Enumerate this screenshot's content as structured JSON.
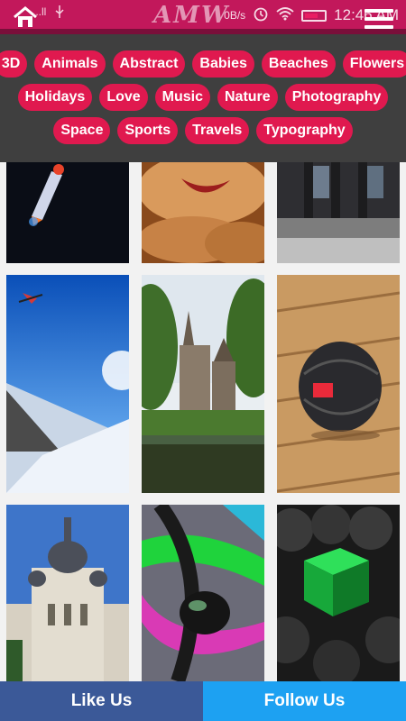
{
  "status_bar": {
    "signal_text": "...ll",
    "usb_icon": "usb-icon",
    "speed": "0B/s",
    "alarm_icon": "alarm-icon",
    "wifi_icon": "wifi-icon",
    "battery_icon": "battery-icon",
    "time": "12:46 AM"
  },
  "header": {
    "brand": "AMW",
    "home_icon": "home-icon",
    "menu_icon": "hamburger-menu-icon"
  },
  "categories": {
    "row1": [
      "3D",
      "Animals",
      "Abstract",
      "Babies",
      "Beaches",
      "Flowers"
    ],
    "row2": [
      "Holidays",
      "Love",
      "Music",
      "Nature",
      "Photography"
    ],
    "row3": [
      "Space",
      "Sports",
      "Travels",
      "Typography"
    ]
  },
  "gallery": {
    "thumbnails": [
      {
        "subject": "space rocket"
      },
      {
        "subject": "baby"
      },
      {
        "subject": "modern building"
      },
      {
        "subject": "snowboard jump"
      },
      {
        "subject": "castle by pond"
      },
      {
        "subject": "red-black sphere on wood"
      },
      {
        "subject": "cathedral"
      },
      {
        "subject": "neon abstract"
      },
      {
        "subject": "green cube among spheres"
      }
    ]
  },
  "bottom": {
    "like_label": "Like Us",
    "follow_label": "Follow Us"
  },
  "colors": {
    "accent": "#e0194f",
    "header": "#c2185b",
    "panel": "#3f3f3f",
    "facebook": "#3b5998",
    "twitter": "#1da1f2"
  }
}
